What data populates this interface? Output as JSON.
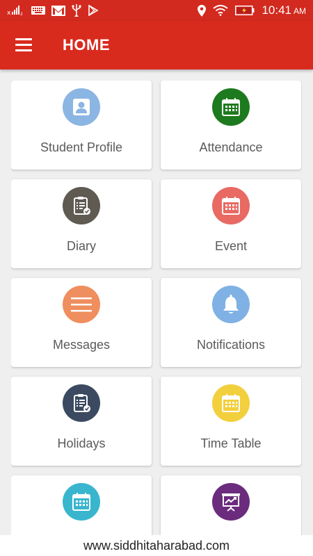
{
  "status_bar": {
    "time": "10:41",
    "ampm": "AM",
    "icons": [
      "signal-icon",
      "keyboard-icon",
      "gmail-icon",
      "usb-icon",
      "play-store-icon",
      "location-icon",
      "wifi-icon",
      "battery-icon"
    ]
  },
  "app_bar": {
    "title": "HOME",
    "menu_icon": "hamburger-menu-icon"
  },
  "tiles": [
    {
      "label": "Student Profile",
      "icon": "profile-icon",
      "color": "#8bb5e3"
    },
    {
      "label": "Attendance",
      "icon": "calendar-icon",
      "color": "#1e7a1e"
    },
    {
      "label": "Diary",
      "icon": "clipboard-check-icon",
      "color": "#5f5a52"
    },
    {
      "label": "Event",
      "icon": "calendar-icon",
      "color": "#e86a63"
    },
    {
      "label": "Messages",
      "icon": "lines-icon",
      "color": "#ef8e5e"
    },
    {
      "label": "Notifications",
      "icon": "bell-icon",
      "color": "#7fb1e4"
    },
    {
      "label": "Holidays",
      "icon": "clipboard-check-icon",
      "color": "#3b4a60"
    },
    {
      "label": "Time Table",
      "icon": "calendar-icon",
      "color": "#f2cf3d"
    },
    {
      "label": "",
      "icon": "calendar-icon",
      "color": "#39b6ce"
    },
    {
      "label": "",
      "icon": "presentation-chart-icon",
      "color": "#6b2c7d"
    }
  ],
  "footer": {
    "text": "www.siddhitaharabad.com"
  },
  "colors": {
    "status_bar": "#d32a1f",
    "app_bar": "#d92a1e",
    "background": "#efefef",
    "tile": "#ffffff",
    "label": "#5a5a5a"
  }
}
